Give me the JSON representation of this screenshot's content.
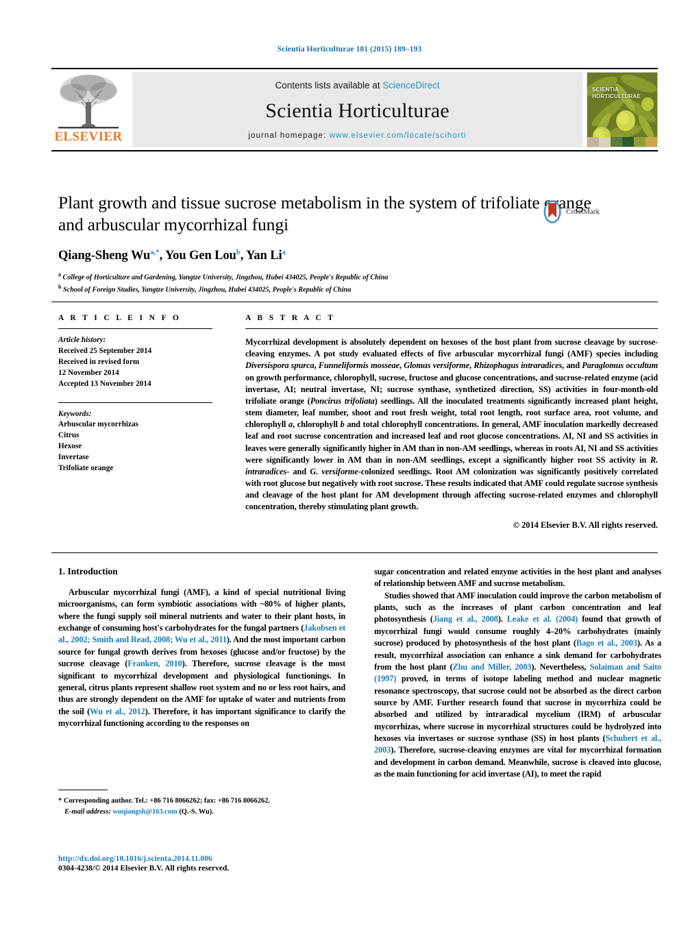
{
  "running_head": "Scientia Horticulturae 181 (2015) 189–193",
  "masthead": {
    "elsevier_wordmark": "ELSEVIER",
    "contents_prefix": "Contents lists available at ",
    "contents_link": "ScienceDirect",
    "journal_title": "Scientia Horticulturae",
    "homepage_prefix": "journal homepage: ",
    "homepage_url": "www.elsevier.com/locate/scihorti",
    "cover_title_line1": "SCIENTIA",
    "cover_title_line2": "HORTICULTURAE"
  },
  "article": {
    "title": "Plant growth and tissue sucrose metabolism in the system of trifoliate orange and arbuscular mycorrhizal fungi",
    "crossmark_label": "CrossMark",
    "authors_html": "Qiang-Sheng Wu<sup>a,*</sup>, You Gen Lou<sup>b</sup>, Yan Li<sup>a</sup>",
    "affiliations": [
      "College of Horticulture and Gardening, Yangtze University, Jingzhou, Hubei 434025, People's Republic of China",
      "School of Foreign Studies, Yangtze University, Jingzhou, Hubei 434025, People's Republic of China"
    ],
    "affiliation_markers": [
      "a",
      "b"
    ]
  },
  "article_info": {
    "heading": "A R T I C L E   I N F O",
    "history_label": "Article history:",
    "history_lines": [
      "Received 25 September 2014",
      "Received in revised form",
      "12 November 2014",
      "Accepted 13 November 2014"
    ],
    "keywords_label": "Keywords:",
    "keywords": [
      "Arbuscular mycorrhizas",
      "Citrus",
      "Hexose",
      "Invertase",
      "Trifoliate orange"
    ]
  },
  "abstract": {
    "heading": "A B S T R A C T",
    "text": "Mycorrhizal development is absolutely dependent on hexoses of the host plant from sucrose cleavage by sucrose-cleaving enzymes. A pot study evaluated effects of five arbuscular mycorrhizal fungi (AMF) species including Diversispora spurca, Funneliformis mosseae, Glomus versiforme, Rhizophagus intraradices, and Paraglomus occultum on growth performance, chlorophyll, sucrose, fructose and glucose concentrations, and sucrose-related enzyme (acid invertase, AI; neutral invertase, NI; sucrose synthase, synthetized direction, SS) activities in four-month-old trifoliate orange (Poncirus trifoliata) seedlings. All the inoculated treatments significantly increased plant height, stem diameter, leaf number, shoot and root fresh weight, total root length, root surface area, root volume, and chlorophyll a, chlorophyll b and total chlorophyll concentrations. In general, AMF inoculation markedly decreased leaf and root sucrose concentration and increased leaf and root glucose concentrations. AI, NI and SS activities in leaves were generally significantly higher in AM than in non-AM seedlings, whereas in roots AI, NI and SS activities were significantly lower in AM than in non-AM seedlings, except a significantly higher root SS activity in R. intraradices- and G. versiforme-colonized seedlings. Root AM colonization was significantly positively correlated with root glucose but negatively with root sucrose. These results indicated that AMF could regulate sucrose synthesis and cleavage of the host plant for AM development through affecting sucrose-related enzymes and chlorophyll concentration, thereby stimulating plant growth.",
    "copyright": "© 2014 Elsevier B.V. All rights reserved."
  },
  "body": {
    "section_heading": "1.  Introduction",
    "left_paragraph_1": "Arbuscular mycorrhizal fungi (AMF), a kind of special nutritional living microorganisms, can form symbiotic associations with ~80% of higher plants, where the fungi supply soil mineral nutrients and water to their plant hosts, in exchange of consuming host's carbohydrates for the fungal partners (Jakobsen et al., 2002; Smith and Read, 2008; Wu et al., 2011). And the most important carbon source for fungal growth derives from hexoses (glucose and/or fructose) by the sucrose cleavage (Franken, 2010). Therefore, sucrose cleavage is the most significant to mycorrhizal development and physiological functionings. In general, citrus plants represent shallow root system and no or less root hairs, and thus are strongly dependent on the AMF for uptake of water and nutrients from the soil (Wu et al., 2012). Therefore, it has important significance to clarify the mycorrhizal functioning according to the responses on",
    "right_paragraph_1": "sugar concentration and related enzyme activities in the host plant and analyses of relationship between AMF and sucrose metabolism.",
    "right_paragraph_2": "Studies showed that AMF inoculation could improve the carbon metabolism of plants, such as the increases of plant carbon concentration and leaf photosynthesis (Jiang et al., 2008). Leake et al. (2004) found that growth of mycorrhizal fungi would consume roughly 4–20% carbohydrates (mainly sucrose) produced by photosynthesis of the host plant (Bago et al., 2003). As a result, mycorrhizal association can enhance a sink demand for carbohydrates from the host plant (Zhu and Miller, 2003). Nevertheless, Solaiman and Saito (1997) proved, in terms of isotope labeling method and nuclear magnetic resonance spectroscopy, that sucrose could not be absorbed as the direct carbon source by AMF. Further research found that sucrose in mycorrhiza could be absorbed and utilized by intraradical mycelium (IRM) of arbuscular mycorrhizas, where sucrose in mycorrhizal structures could be hydrolyzed into hexoses via invertases or sucrose synthase (SS) in host plants (Schubert et al., 2003). Therefore, sucrose-cleaving enzymes are vital for mycorrhizal formation and development in carbon demand. Meanwhile, sucrose is cleaved into glucose, as the main functioning for acid invertase (AI), to meet the rapid"
  },
  "footnote": {
    "marker": "*",
    "corresponding": "Corresponding author. Tel.: +86 716 8066262; fax: +86 716 8066262.",
    "email_label": "E-mail address:",
    "email": "wuqiangsh@163.com",
    "email_suffix": "(Q.-S. Wu)."
  },
  "footer": {
    "doi": "http://dx.doi.org/10.1016/j.scienta.2014.11.006",
    "issn_line": "0304-4238/© 2014 Elsevier B.V. All rights reserved."
  },
  "colors": {
    "link": "#1c7cb5",
    "sciencedirect": "#2b8fc4",
    "elsevier_orange": "#E87722",
    "masthead_bg": "#e9e9e9"
  }
}
